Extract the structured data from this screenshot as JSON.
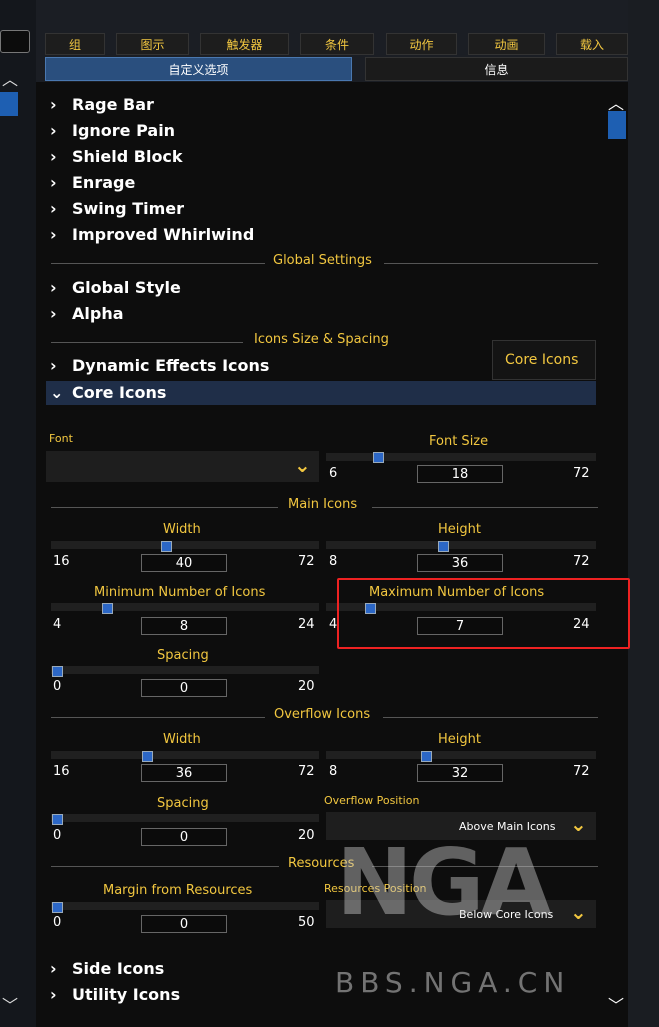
{
  "tabs": [
    "组",
    "图示",
    "触发器",
    "条件",
    "动作",
    "动画",
    "载入"
  ],
  "subtabs": {
    "custom": "自定义选项",
    "info": "信息"
  },
  "tree_items": [
    "Rage Bar",
    "Ignore Pain",
    "Shield Block",
    "Enrage",
    "Swing Timer",
    "Improved Whirlwind"
  ],
  "global_header": "Global Settings",
  "global_items": [
    "Global Style",
    "Alpha"
  ],
  "icons_header": "Icons Size & Spacing",
  "dynamic_item": "Dynamic Effects Icons",
  "core_item": "Core Icons",
  "core_tooltip": "Core Icons",
  "font": {
    "label": "Font",
    "value": ""
  },
  "font_size": {
    "label": "Font Size",
    "min": "6",
    "max": "72",
    "value": "18",
    "fraction": 0.18
  },
  "main_header": "Main Icons",
  "main_width": {
    "label": "Width",
    "min": "16",
    "max": "72",
    "value": "40",
    "fraction": 0.43
  },
  "main_height": {
    "label": "Height",
    "min": "8",
    "max": "72",
    "value": "36",
    "fraction": 0.44
  },
  "min_icons": {
    "label": "Minimum Number of Icons",
    "min": "4",
    "max": "24",
    "value": "8",
    "fraction": 0.2
  },
  "max_icons": {
    "label": "Maximum Number of Icons",
    "min": "4",
    "max": "24",
    "value": "7",
    "fraction": 0.15
  },
  "main_spacing": {
    "label": "Spacing",
    "min": "0",
    "max": "20",
    "value": "0",
    "fraction": 0
  },
  "overflow_header": "Overflow Icons",
  "of_width": {
    "label": "Width",
    "min": "16",
    "max": "72",
    "value": "36",
    "fraction": 0.36
  },
  "of_height": {
    "label": "Height",
    "min": "8",
    "max": "72",
    "value": "32",
    "fraction": 0.38
  },
  "of_spacing": {
    "label": "Spacing",
    "min": "0",
    "max": "20",
    "value": "0",
    "fraction": 0
  },
  "overflow_position": {
    "label": "Overflow Position",
    "value": "Above Main Icons"
  },
  "resources_header": "Resources",
  "margin_resources": {
    "label": "Margin from Resources",
    "min": "0",
    "max": "50",
    "value": "0",
    "fraction": 0
  },
  "resources_position": {
    "label": "Resources Position",
    "value": "Below Core Icons"
  },
  "bottom_items": [
    "Side Icons",
    "Utility Icons"
  ],
  "watermark": "BBS.NGA.CN",
  "logo": "NGA",
  "colors": {
    "gold": "#f2c740",
    "accent": "#2c67c6",
    "highlight": "#e22222"
  }
}
